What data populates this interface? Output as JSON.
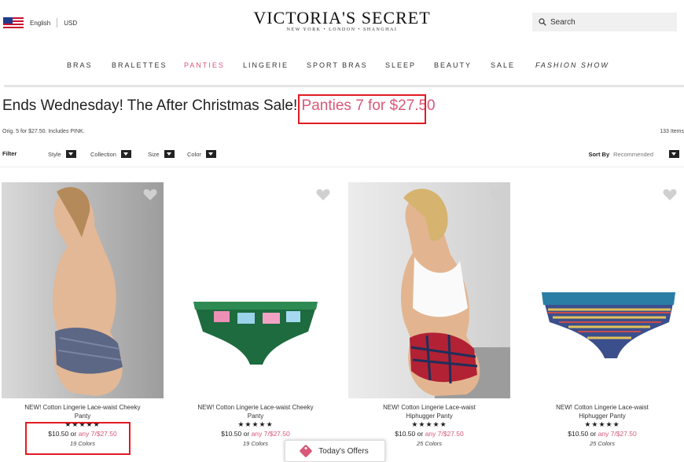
{
  "header": {
    "language": "English",
    "currency": "USD",
    "logo_main": "VICTORIA'S SECRET",
    "logo_sub": "NEW YORK • LONDON • SHANGHAI",
    "search_placeholder": "Search"
  },
  "nav": {
    "items": [
      "BRAS",
      "BRALETTES",
      "PANTIES",
      "LINGERIE",
      "SPORT BRAS",
      "SLEEP",
      "BEAUTY",
      "SALE",
      "FASHION SHOW"
    ],
    "active": "PANTIES"
  },
  "headline": {
    "text": "Ends Wednesday! The After Christmas Sale!",
    "promo": "Panties 7 for $27.50"
  },
  "subline": {
    "orig": "Orig. 5 for $27.50. Includes PINK.",
    "count": "133 Items"
  },
  "filters": {
    "label": "Filter",
    "items": [
      "Style",
      "Collection",
      "Size",
      "Color"
    ],
    "sort_label": "Sort By",
    "sort_value": "Recommended"
  },
  "products": [
    {
      "name_line1": "NEW! Cotton Lingerie Lace-waist Cheeky",
      "name_line2": "Panty",
      "rating": "★★★★★",
      "price": "$10.50 or",
      "offer": "any 7/$27.50",
      "colors": "19 Colors"
    },
    {
      "name_line1": "NEW! Cotton Lingerie Lace-waist Cheeky",
      "name_line2": "Panty",
      "rating": "★★★★★",
      "price": "$10.50 or",
      "offer": "any 7/$27.50",
      "colors": "19 Colors"
    },
    {
      "name_line1": "NEW! Cotton Lingerie Lace-waist",
      "name_line2": "Hiphugger Panty",
      "rating": "★★★★★",
      "price": "$10.50 or",
      "offer": "any 7/$27.50",
      "colors": "25 Colors"
    },
    {
      "name_line1": "NEW! Cotton Lingerie Lace-waist",
      "name_line2": "Hiphugger Panty",
      "rating": "★★★★★",
      "price": "$10.50 or",
      "offer": "any 7/$27.50",
      "colors": "25 Colors"
    }
  ],
  "offers_button": "Today's Offers",
  "colors": {
    "accent": "#d8587a",
    "highlight_box": "#e11b22"
  }
}
